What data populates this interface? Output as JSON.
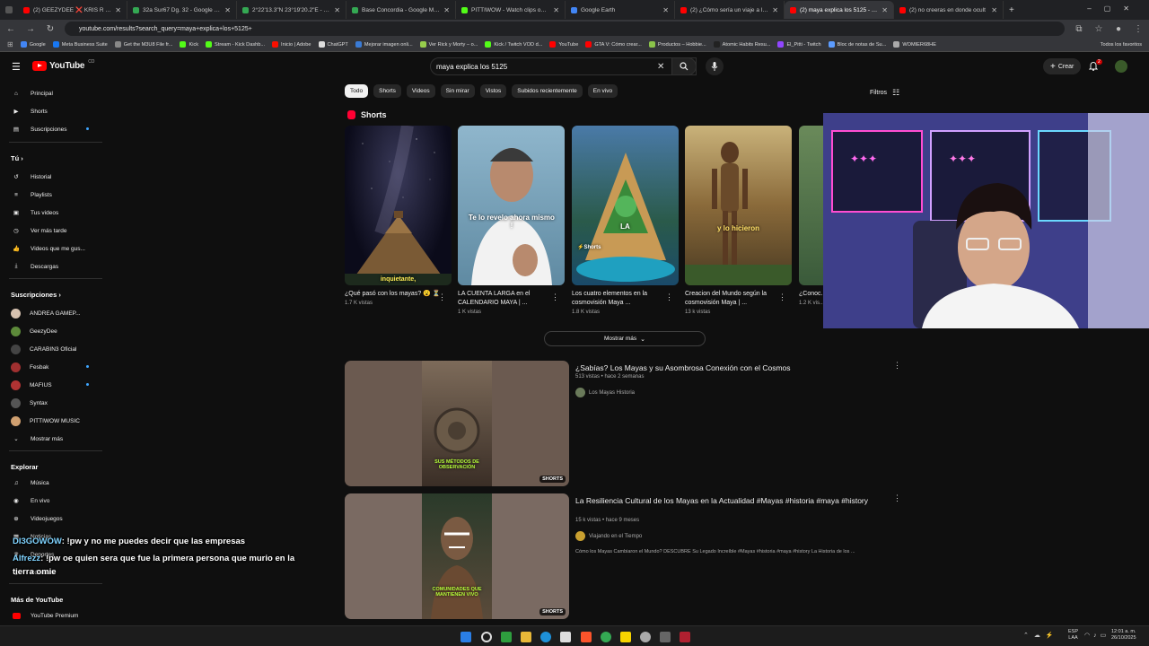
{
  "browser": {
    "tabs": [
      {
        "label": "(2) GEEZYDEE ❌ KRIS R - PAR",
        "color": "#ff0000",
        "active": false
      },
      {
        "label": "32a Sur67 Dg. 32 - Google Ma",
        "color": "#34a853",
        "active": false
      },
      {
        "label": "2°22'13.3\"N 23°19'20.2\"E - Go",
        "color": "#34a853",
        "active": false
      },
      {
        "label": "Base Concordia - Google Maps",
        "color": "#34a853",
        "active": false
      },
      {
        "label": "PITTIWOW - Watch clips on Kic",
        "color": "#53fc18",
        "active": false
      },
      {
        "label": "Google Earth",
        "color": "#4285f4",
        "active": false
      },
      {
        "label": "(2) ¿Cómo sería un viaje a la fo",
        "color": "#ff0000",
        "active": false
      },
      {
        "label": "(2) maya explica los 5125 - You",
        "color": "#ff0000",
        "active": true
      },
      {
        "label": "(2) no creeras en donde ocult",
        "color": "#ff0000",
        "active": false
      }
    ],
    "url": "youtube.com/results?search_query=maya+explica+los+5125+",
    "bookmarks": [
      {
        "label": "Google",
        "color": "#4285f4"
      },
      {
        "label": "Meta Business Suite",
        "color": "#1877f2"
      },
      {
        "label": "Get the M3U8 File fr...",
        "color": "#888888"
      },
      {
        "label": "Kick",
        "color": "#53fc18"
      },
      {
        "label": "Stream - Kick Dashb...",
        "color": "#53fc18"
      },
      {
        "label": "Inicio | Adobe",
        "color": "#fa0f00"
      },
      {
        "label": "ChatGPT",
        "color": "#dddddd"
      },
      {
        "label": "Mejorar imagen onli...",
        "color": "#3a7bd5"
      },
      {
        "label": "Ver Rick y Morty – o...",
        "color": "#97ce4c"
      },
      {
        "label": "Kick / Twitch VOD d...",
        "color": "#53fc18"
      },
      {
        "label": "YouTube",
        "color": "#ff0000"
      },
      {
        "label": "GTA V: Cómo crear...",
        "color": "#ff0000"
      },
      {
        "label": "Productos – Hobbie...",
        "color": "#8bc34a"
      },
      {
        "label": "Atomic Habits Resu...",
        "color": "#222222"
      },
      {
        "label": "El_Pitti - Twitch",
        "color": "#9146ff"
      },
      {
        "label": "Bloc de notas de Su...",
        "color": "#5c9cff"
      },
      {
        "label": "WOMIER68HE",
        "color": "#aaaaaa"
      }
    ],
    "bookmarks_all": "Todos los favoritos"
  },
  "youtube": {
    "logo_text": "YouTube",
    "logo_country": "CO",
    "search_value": "maya explica los 5125",
    "create_label": "Crear",
    "notifications_count": "2"
  },
  "sidebar": {
    "main": [
      {
        "label": "Principal",
        "icon": "home-icon"
      },
      {
        "label": "Shorts",
        "icon": "shorts-icon"
      },
      {
        "label": "Suscripciones",
        "icon": "subscriptions-icon"
      }
    ],
    "you_heading": "Tú",
    "you": [
      {
        "label": "Historial",
        "icon": "history-icon"
      },
      {
        "label": "Playlists",
        "icon": "playlist-icon"
      },
      {
        "label": "Tus videos",
        "icon": "video-icon"
      },
      {
        "label": "Ver más tarde",
        "icon": "clock-icon"
      },
      {
        "label": "Videos que me gus...",
        "icon": "like-icon"
      },
      {
        "label": "Descargas",
        "icon": "download-icon"
      }
    ],
    "subs_heading": "Suscripciones",
    "subs": [
      {
        "label": "ANDREA GAMEP...",
        "color": "#d7c2b0"
      },
      {
        "label": "GeezyDee",
        "color": "#5d8a3a"
      },
      {
        "label": "CARABIN3 Oficial",
        "color": "#444444"
      },
      {
        "label": "Fesbak",
        "color": "#a03030"
      },
      {
        "label": "MAFIUS",
        "color": "#b03333"
      },
      {
        "label": "Syntax",
        "color": "#555555"
      },
      {
        "label": "PITTIWOW MUSIC",
        "color": "#d0a070"
      }
    ],
    "show_more": "Mostrar más",
    "explore_heading": "Explorar",
    "explore": [
      {
        "label": "Música",
        "icon": "music-icon"
      },
      {
        "label": "En vivo",
        "icon": "live-icon"
      },
      {
        "label": "Videojuegos",
        "icon": "gamepad-icon"
      },
      {
        "label": "Noticias",
        "icon": "news-icon"
      },
      {
        "label": "Deportes",
        "icon": "trophy-icon"
      },
      {
        "label": "Pódcasts",
        "icon": "podcast-icon"
      }
    ],
    "more_heading": "Más de YouTube",
    "premium": "YouTube Premium"
  },
  "chips": [
    "Todo",
    "Shorts",
    "Videos",
    "Sin mirar",
    "Vistos",
    "Subidos recientemente",
    "En vivo"
  ],
  "filters_label": "Filtros",
  "shorts_section": {
    "heading": "Shorts",
    "items": [
      {
        "title": "¿Qué pasó con los mayas? 😮 ⏳",
        "views": "1.7 K vistas",
        "overlay": "inquietante,"
      },
      {
        "title": "LA CUENTA LARGA en el CALENDARIO MAYA | ...",
        "views": "1 K vistas",
        "overlay": "Te lo revelo ahora mismo !"
      },
      {
        "title": "Los cuatro elementos en la cosmovisión Maya ...",
        "views": "1.8 K vistas",
        "overlay": "LA"
      },
      {
        "title": "Creacion del Mundo según la cosmovisión Maya | ...",
        "views": "13 k vistas",
        "overlay": "y lo hicieron"
      },
      {
        "title": "¿Conoc... mayas?...",
        "views": "1.2 K vis...",
        "overlay": ""
      }
    ],
    "show_more": "Mostrar más"
  },
  "videos": [
    {
      "title": "¿Sabías? Los Mayas y su Asombrosa Conexión con el Cosmos",
      "meta": "513 vistas • hace 2 semanas",
      "channel": "Los Mayas Historia",
      "badge": "SHORTS",
      "overlay": "SUS MÉTODOS DE OBSERVACIÓN",
      "desc": ""
    },
    {
      "title": "La Resiliencia Cultural de los Mayas en la Actualidad #Mayas #historia #maya #history",
      "meta": "15 k vistas • hace 9 meses",
      "channel": "Viajando en el Tiempo",
      "badge": "SHORTS",
      "overlay": "COMUNIDADES QUE MANTIENEN VIVO",
      "desc": "Cómo los Mayas Cambiaron el Mundo? DESCUBRE Su Legado Increíble #Mayas #historia #maya #history La Historia de los ..."
    }
  ],
  "chat": [
    {
      "user": "DI3GOWOW",
      "text": ": !pw y no me puedes decir que las empresas"
    },
    {
      "user": "Alfrezz",
      "text": ": !pw oe quien sera que fue la primera persona que murio en la"
    },
    {
      "user": "",
      "text": "tierra omie"
    }
  ],
  "taskbar": {
    "lang": "ESP",
    "lang2": "LAA",
    "time": "12:01 a. m.",
    "date": "26/10/2025"
  }
}
